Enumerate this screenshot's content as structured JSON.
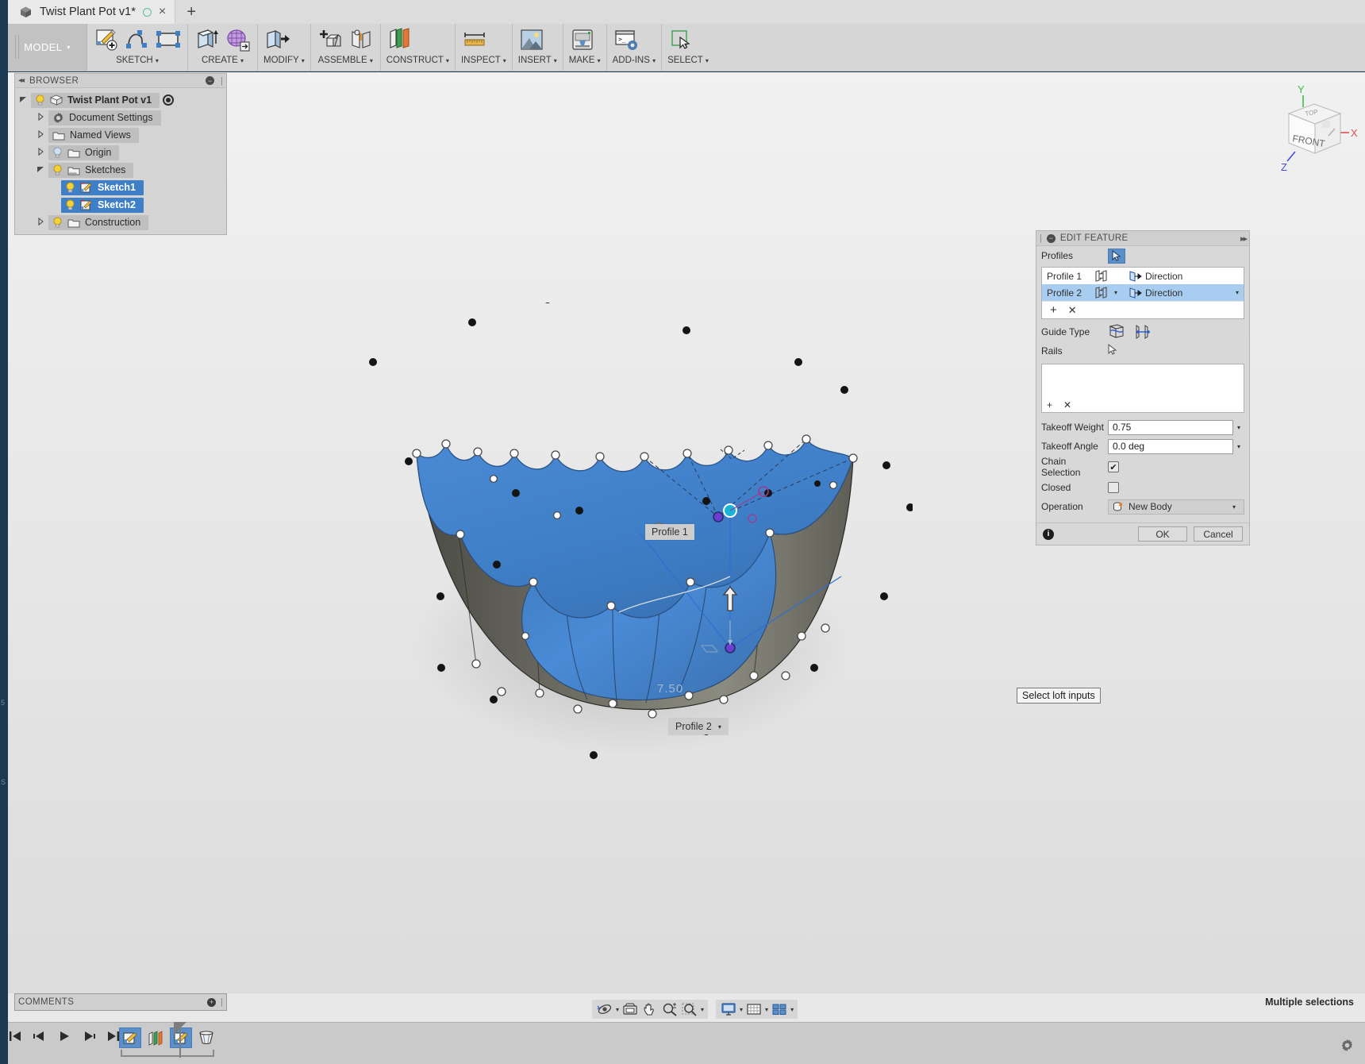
{
  "app": {
    "tab_title": "Twist Plant Pot v1*",
    "new_tab_label": "+",
    "close_label": "×",
    "workspace_label": "MODEL"
  },
  "ribbon": {
    "groups": [
      {
        "label": "SKETCH",
        "icons": [
          "create-sketch-icon",
          "spline-icon",
          "rectangle-icon"
        ]
      },
      {
        "label": "CREATE",
        "icons": [
          "extrude-icon",
          "form-icon"
        ]
      },
      {
        "label": "MODIFY",
        "icons": [
          "press-pull-icon"
        ]
      },
      {
        "label": "ASSEMBLE",
        "icons": [
          "new-component-icon",
          "joint-icon"
        ]
      },
      {
        "label": "CONSTRUCT",
        "icons": [
          "offset-plane-icon"
        ]
      },
      {
        "label": "INSPECT",
        "icons": [
          "measure-icon"
        ]
      },
      {
        "label": "INSERT",
        "icons": [
          "insert-mcmaster-icon"
        ]
      },
      {
        "label": "MAKE",
        "icons": [
          "3d-print-icon"
        ]
      },
      {
        "label": "ADD-INS",
        "icons": [
          "scripts-addins-icon"
        ]
      },
      {
        "label": "SELECT",
        "icons": [
          "select-icon"
        ]
      }
    ],
    "caret": "▾"
  },
  "browser": {
    "title": "BROWSER",
    "collapse_icon": "◂◂",
    "minimize_label": "−",
    "tree": [
      {
        "label": "Twist Plant Pot v1",
        "level": 0,
        "arrow": "expanded",
        "icon": "component-cube-icon",
        "bulb": true,
        "selected": false,
        "root": true,
        "radio": true
      },
      {
        "label": "Document Settings",
        "level": 1,
        "arrow": "collapsed",
        "icon": "gear-icon",
        "bulb": false,
        "selected": false
      },
      {
        "label": "Named Views",
        "level": 1,
        "arrow": "collapsed",
        "icon": "folder-icon",
        "bulb": false,
        "selected": false
      },
      {
        "label": "Origin",
        "level": 1,
        "arrow": "collapsed",
        "icon": "folder-icon",
        "bulb": true,
        "selected": false
      },
      {
        "label": "Sketches",
        "level": 1,
        "arrow": "expanded",
        "icon": "folder-sketch-icon",
        "bulb": true,
        "selected": false
      },
      {
        "label": "Sketch1",
        "level": 2,
        "arrow": "none",
        "icon": "sketch-icon",
        "bulb": true,
        "selected": true
      },
      {
        "label": "Sketch2",
        "level": 2,
        "arrow": "none",
        "icon": "sketch-icon",
        "bulb": true,
        "selected": true
      },
      {
        "label": "Construction",
        "level": 1,
        "arrow": "collapsed",
        "icon": "folder-icon",
        "bulb": true,
        "selected": false
      }
    ]
  },
  "dialog": {
    "title": "EDIT FEATURE",
    "collapse_icon": "−",
    "pin_icon": "▸▸",
    "profiles_label": "Profiles",
    "select_icon": "cursor-arrow-icon",
    "profiles": [
      {
        "name": "Profile 1",
        "direction": "Direction",
        "highlighted": false,
        "has_caret": false
      },
      {
        "name": "Profile 2",
        "direction": "Direction",
        "highlighted": true,
        "has_caret": true
      }
    ],
    "add_label": "+",
    "remove_label": "✕",
    "guide_type_label": "Guide Type",
    "guide_types": [
      "rails-icon",
      "centerline-icon"
    ],
    "rails_label": "Rails",
    "rails_items": [],
    "takeoff_weight_label": "Takeoff Weight",
    "takeoff_weight_value": "0.75",
    "takeoff_angle_label": "Takeoff Angle",
    "takeoff_angle_value": "0.0 deg",
    "chain_selection_label": "Chain Selection",
    "chain_selection_checked": true,
    "closed_label": "Closed",
    "closed_checked": false,
    "operation_label": "Operation",
    "operation_value": "New Body",
    "ok_label": "OK",
    "cancel_label": "Cancel",
    "info_label": "i",
    "caret": "▾",
    "check_glyph": "✔",
    "accent_selected": "#a8cdf0",
    "accent_button": "#5b8fc9"
  },
  "canvas": {
    "profile1_label": "Profile 1",
    "profile2_label": "Profile 2",
    "profile2_caret": "▾",
    "dimension_value": "7.50",
    "tooltip": "Select loft inputs",
    "surface_color": "#3f7fc8",
    "inner_color": "#6b6b63",
    "viewcube": {
      "top_face": "TOP",
      "front_face": "FRONT",
      "axis_x": "X",
      "axis_y": "Y",
      "axis_z": "Z",
      "x_color": "#e05050",
      "y_color": "#3fbf3f",
      "z_color": "#4a4ae0"
    }
  },
  "comments": {
    "title": "COMMENTS",
    "add_label": "+"
  },
  "status": {
    "text": "Multiple selections"
  },
  "navbar": {
    "group1": [
      "orbit-icon",
      "look-at-icon",
      "pan-icon",
      "zoom-icon",
      "zoom-window-icon"
    ],
    "group2": [
      "display-settings-icon",
      "grid-snap-icon",
      "viewports-icon"
    ],
    "caret": "▾"
  },
  "timeline": {
    "buttons": [
      "go-to-beginning-icon",
      "step-back-icon",
      "play-icon",
      "step-forward-icon",
      "go-to-end-icon"
    ],
    "features": [
      {
        "icon": "sketch-icon",
        "selected": true
      },
      {
        "icon": "offset-plane-icon",
        "selected": false
      },
      {
        "icon": "sketch-icon",
        "selected": true
      },
      {
        "icon": "loft-icon",
        "selected": false
      }
    ],
    "settings_icon": "gear-icon"
  }
}
